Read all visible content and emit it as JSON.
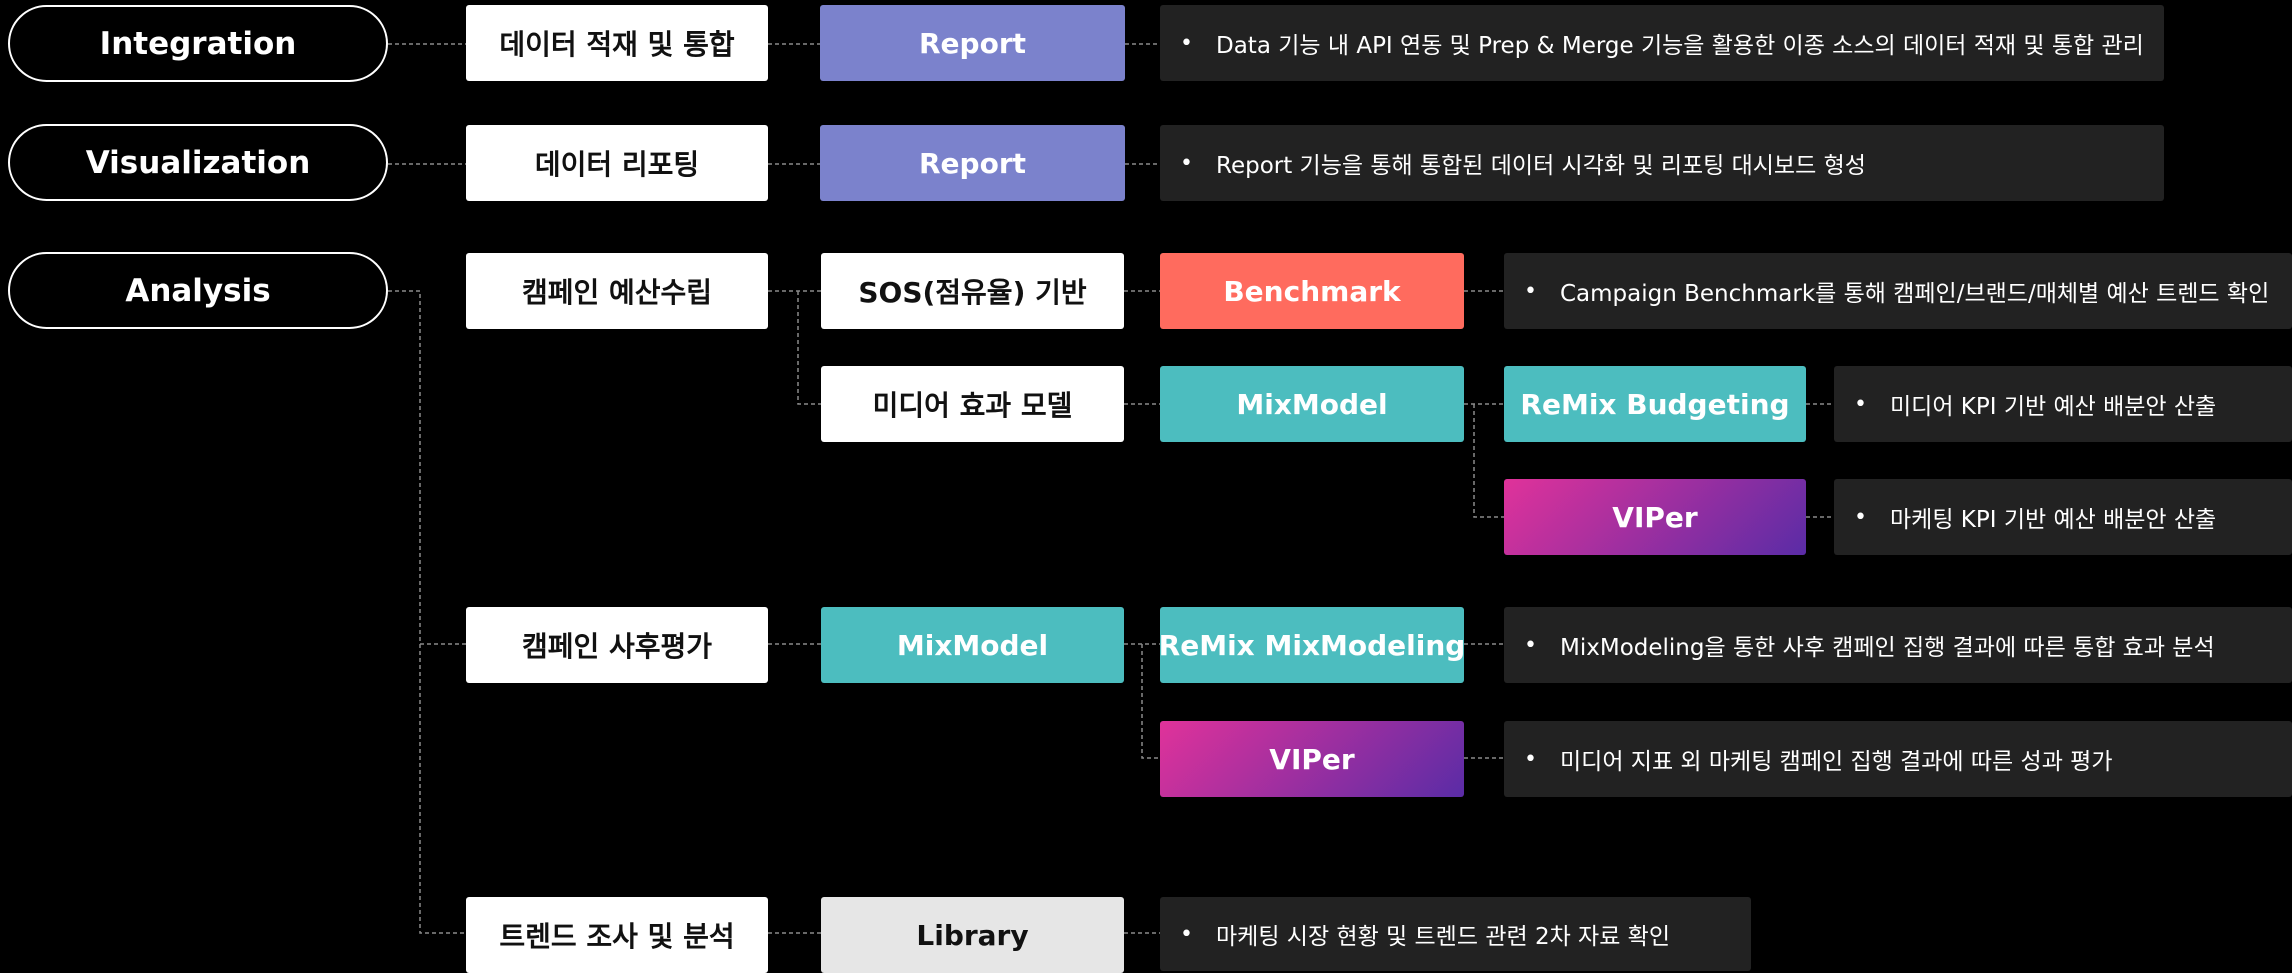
{
  "colors": {
    "report": "#7b82cc",
    "benchmark": "#ff6b5e",
    "mixmodel": "#4cbdbf",
    "viper_start": "#e0329a",
    "viper_end": "#5a2ca6",
    "library": "#e6e6e6",
    "description_bg": "#222222",
    "connector": "#8a8a8a"
  },
  "categories": {
    "integration": "Integration",
    "visualization": "Visualization",
    "analysis": "Analysis"
  },
  "topics": {
    "data_loading": "데이터 적재 및 통합",
    "data_reporting": "데이터 리포팅",
    "campaign_budget": "캠페인 예산수립",
    "campaign_review": "캠페인 사후평가",
    "trend_research": "트렌드 조사 및 분석"
  },
  "methods": {
    "sos": "SOS(점유율) 기반",
    "media_model": "미디어 효과 모델"
  },
  "tools": {
    "report_1": "Report",
    "report_2": "Report",
    "benchmark": "Benchmark",
    "mixmodel_budget": "MixModel",
    "remix_budgeting": "ReMix Budgeting",
    "viper_budget": "VIPer",
    "mixmodel_review": "MixModel",
    "remix_mixmodeling": "ReMix MixModeling",
    "viper_review": "VIPer",
    "library": "Library"
  },
  "descriptions": {
    "integration": "Data 기능 내 API 연동 및 Prep & Merge 기능을 활용한 이종 소스의 데이터 적재 및 통합 관리",
    "visualization": "Report 기능을 통해 통합된 데이터 시각화 및 리포팅 대시보드 형성",
    "benchmark": "Campaign Benchmark를 통해 캠페인/브랜드/매체별 예산 트렌드 확인",
    "remix_budgeting": "미디어 KPI 기반 예산 배분안 산출",
    "viper_budget": "마케팅 KPI 기반 예산 배분안 산출",
    "remix_mixmodeling": "MixModeling을 통한 사후 캠페인 집행 결과에 따른 통합 효과 분석",
    "viper_review": "미디어 지표 외 마케팅 캠페인 집행 결과에 따른 성과 평가",
    "library": "마케팅 시장 현황 및 트렌드 관련 2차 자료 확인"
  },
  "bullet": "•"
}
